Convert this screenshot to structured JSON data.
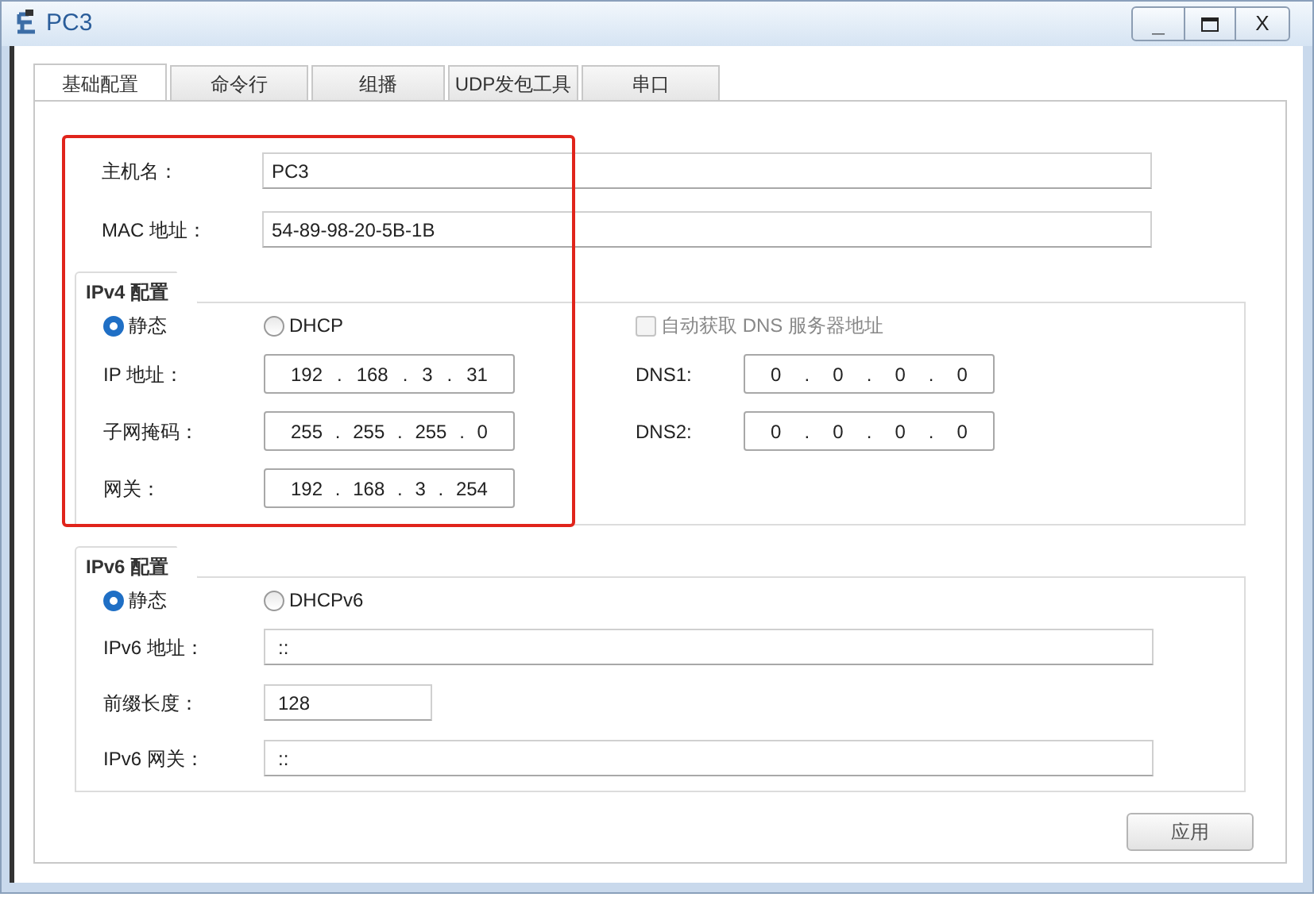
{
  "window": {
    "title": "PC3",
    "controls": [
      {
        "kind": "minimize",
        "label": "_"
      },
      {
        "kind": "maximize"
      },
      {
        "kind": "close",
        "label": "X"
      }
    ]
  },
  "tabs": [
    {
      "label": "基础配置",
      "selected": true
    },
    {
      "label": "命令行",
      "selected": false
    },
    {
      "label": "组播",
      "selected": false
    },
    {
      "label": "UDP发包工具",
      "selected": false
    },
    {
      "label": "串口",
      "selected": false
    }
  ],
  "host": [
    {
      "label": "主机名：",
      "value": "PC3"
    },
    {
      "label": "MAC 地址：",
      "value": "54-89-98-20-5B-1B"
    }
  ],
  "ipv4": {
    "title": "IPv4 配置",
    "modes": [
      {
        "label": "静态",
        "selected": true
      },
      {
        "label": "DHCP",
        "selected": false
      }
    ],
    "dns_auto": {
      "label": "自动获取 DNS 服务器地址",
      "checked": false,
      "disabled": true
    },
    "fields": [
      {
        "label": "IP 地址：",
        "segments": [
          "192",
          ".",
          "168",
          ".",
          "3",
          ".",
          "31"
        ]
      },
      {
        "label": "子网掩码：",
        "segments": [
          "255",
          ".",
          "255",
          ".",
          "255",
          ".",
          "0"
        ]
      },
      {
        "label": "网关：",
        "segments": [
          "192",
          ".",
          "168",
          ".",
          "3",
          ".",
          "254"
        ]
      }
    ],
    "dns": [
      {
        "label": "DNS1:",
        "segments": [
          "0",
          ".",
          "0",
          ".",
          "0",
          ".",
          "0"
        ]
      },
      {
        "label": "DNS2:",
        "segments": [
          "0",
          ".",
          "0",
          ".",
          "0",
          ".",
          "0"
        ]
      }
    ]
  },
  "ipv6": {
    "title": "IPv6 配置",
    "modes": [
      {
        "label": "静态",
        "selected": true
      },
      {
        "label": "DHCPv6",
        "selected": false
      }
    ],
    "fields": [
      {
        "kind": "wide",
        "label": "IPv6 地址：",
        "value": "::"
      },
      {
        "kind": "short",
        "label": "前缀长度：",
        "value": "128"
      },
      {
        "kind": "wide",
        "label": "IPv6 网关：",
        "value": "::"
      }
    ]
  },
  "apply_button": "应用"
}
